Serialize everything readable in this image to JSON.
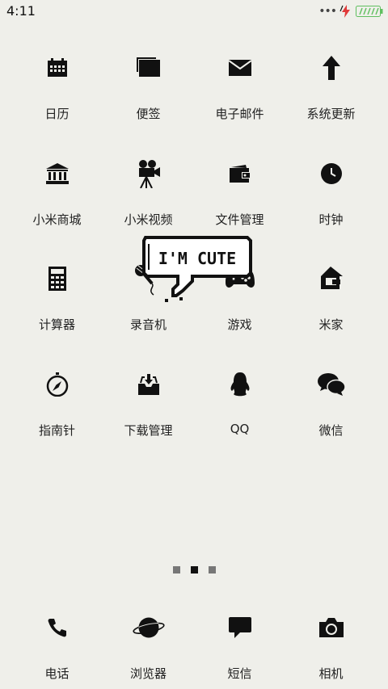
{
  "status": {
    "time": "4:11"
  },
  "sticker": {
    "text": "I'M CUTE"
  },
  "apps": [
    {
      "label": "日历",
      "icon": "calendar-icon"
    },
    {
      "label": "便签",
      "icon": "notes-icon"
    },
    {
      "label": "电子邮件",
      "icon": "mail-icon"
    },
    {
      "label": "系统更新",
      "icon": "update-arrow-icon"
    },
    {
      "label": "小米商城",
      "icon": "store-icon"
    },
    {
      "label": "小米视频",
      "icon": "video-camera-icon"
    },
    {
      "label": "文件管理",
      "icon": "wallet-icon"
    },
    {
      "label": "时钟",
      "icon": "clock-icon"
    },
    {
      "label": "计算器",
      "icon": "calculator-icon"
    },
    {
      "label": "录音机",
      "icon": "microphone-icon"
    },
    {
      "label": "游戏",
      "icon": "gamepad-icon"
    },
    {
      "label": "米家",
      "icon": "home-icon"
    },
    {
      "label": "指南针",
      "icon": "compass-icon"
    },
    {
      "label": "下载管理",
      "icon": "download-tray-icon"
    },
    {
      "label": "QQ",
      "icon": "qq-penguin-icon"
    },
    {
      "label": "微信",
      "icon": "wechat-icon"
    }
  ],
  "dock": [
    {
      "label": "电话",
      "icon": "phone-icon"
    },
    {
      "label": "浏览器",
      "icon": "planet-icon"
    },
    {
      "label": "短信",
      "icon": "message-icon"
    },
    {
      "label": "相机",
      "icon": "camera-icon"
    }
  ],
  "pages": {
    "count": 3,
    "active": 2
  },
  "colors": {
    "background": "#efefea",
    "icon": "#111111",
    "battery": "#5fbf5f",
    "charge": "#e03a3a"
  }
}
